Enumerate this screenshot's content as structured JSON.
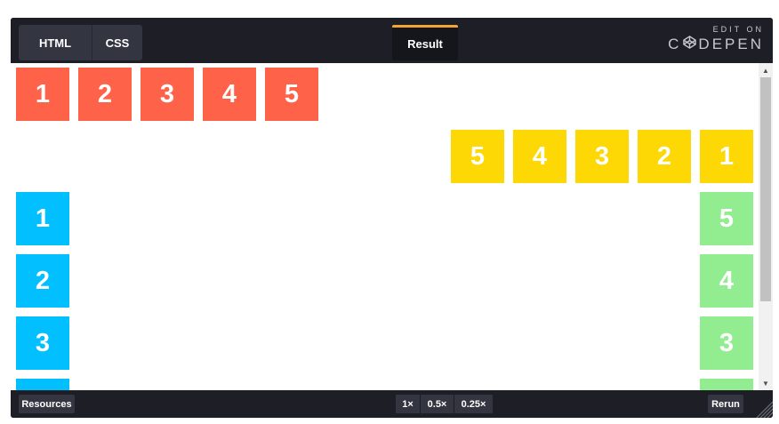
{
  "tabs": {
    "html": "HTML",
    "css": "CSS",
    "result": "Result"
  },
  "brand": {
    "edit_on": "EDIT ON",
    "codepen_left": "C",
    "codepen_right": "DEPEN"
  },
  "boxes": {
    "red": [
      "1",
      "2",
      "3",
      "4",
      "5"
    ],
    "yellow": [
      "5",
      "4",
      "3",
      "2",
      "1"
    ],
    "blue": [
      "1",
      "2",
      "3",
      ""
    ],
    "green": [
      "5",
      "4",
      "3",
      ""
    ]
  },
  "colors": {
    "red": "#fe6249",
    "yellow": "#fdd805",
    "blue": "#02bfff",
    "green": "#92ec90",
    "accent": "#f2a62f"
  },
  "bottom": {
    "resources": "Resources",
    "zoom": [
      "1×",
      "0.5×",
      "0.25×"
    ],
    "rerun": "Rerun"
  }
}
